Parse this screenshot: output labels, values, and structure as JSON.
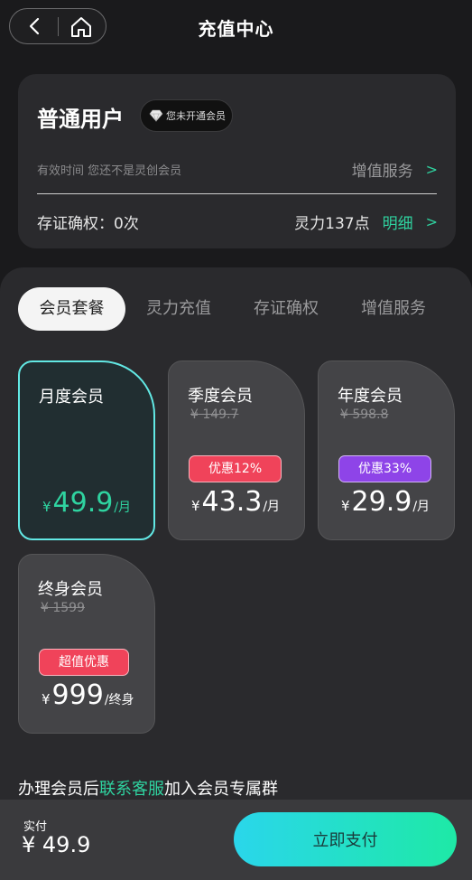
{
  "header": {
    "title": "充值中心",
    "icons": {
      "back": "chevron-left-icon",
      "home": "home-icon"
    }
  },
  "user": {
    "name": "普通用户",
    "vip_badge": "您未开通会员",
    "valid_text": "有效时间 您还不是灵创会员",
    "vas_link": "增值服务",
    "cert_count": "存证确权：0次",
    "points": "灵力137点",
    "detail_link": "明细",
    "chevron": ">"
  },
  "tabs": [
    {
      "label": "会员套餐",
      "active": true
    },
    {
      "label": "灵力充值",
      "active": false
    },
    {
      "label": "存证确权",
      "active": false
    },
    {
      "label": "增值服务",
      "active": false
    }
  ],
  "plans": [
    {
      "name": "月度会员",
      "original_price": "",
      "promo": "",
      "currency": "¥",
      "price": "49.9",
      "unit": "/月",
      "selected": true
    },
    {
      "name": "季度会员",
      "original_price": "¥ 149.7",
      "promo": "优惠12%",
      "promo_color": "#f0435a",
      "currency": "¥",
      "price": "43.3",
      "unit": "/月",
      "selected": false
    },
    {
      "name": "年度会员",
      "original_price": "¥ 598.8",
      "promo": "优惠33%",
      "promo_color": "#8e44e8",
      "currency": "¥",
      "price": "29.9",
      "unit": "/月",
      "selected": false
    },
    {
      "name": "终身会员",
      "original_price": "¥ 1599",
      "promo": "超值优惠",
      "promo_color": "#f0435a",
      "currency": "¥",
      "price": "999",
      "unit": "/终身",
      "selected": false
    }
  ],
  "contact": {
    "prefix": "办理会员后",
    "link": "联系客服",
    "suffix": "加入会员专属群"
  },
  "footer": {
    "pay_label": "实付",
    "pay_amount": "¥ 49.9",
    "pay_button": "立即支付"
  },
  "colors": {
    "accent": "#2fd3a0",
    "selected_border": "#62e8e4",
    "pay_gradient_start": "#2ad6eb",
    "pay_gradient_end": "#1ee9a6"
  }
}
